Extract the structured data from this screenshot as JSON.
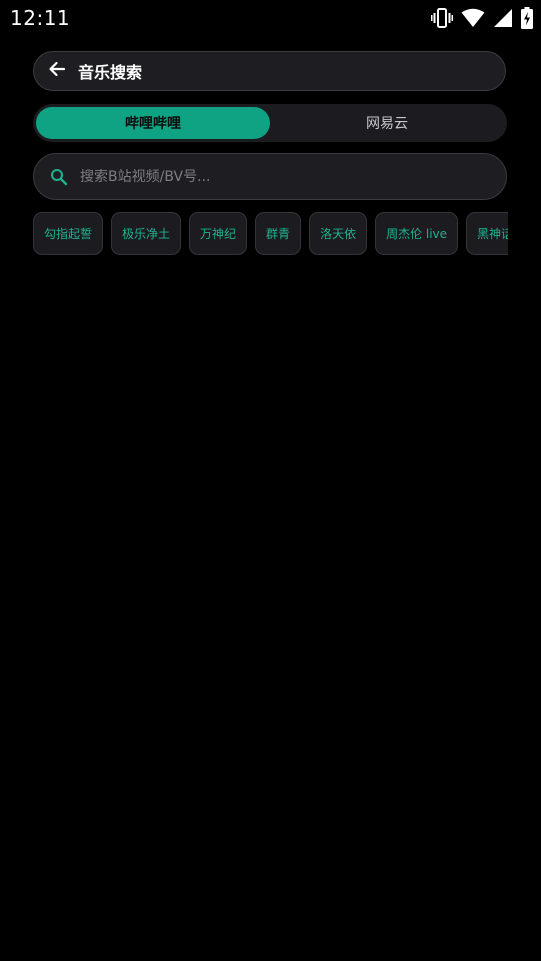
{
  "status_bar": {
    "time": "12:11",
    "icons": [
      "vibrate-icon",
      "wifi-icon",
      "cell-signal-icon",
      "battery-charging-icon"
    ]
  },
  "header": {
    "title": "音乐搜索",
    "back_icon": "arrow-left-icon"
  },
  "source_tabs": [
    {
      "label": "哔哩哔哩",
      "active": true
    },
    {
      "label": "网易云",
      "active": false
    }
  ],
  "search": {
    "placeholder": "搜索B站视频/BV号...",
    "value": "",
    "icon": "search-icon"
  },
  "tags": [
    "勾指起誓",
    "极乐净土",
    "万神纪",
    "群青",
    "洛天依",
    "周杰伦 live",
    "黑神话"
  ],
  "colors": {
    "accent": "#10a383",
    "tag_text": "#1fb28f",
    "surface": "#1e1e22",
    "background": "#000000"
  }
}
